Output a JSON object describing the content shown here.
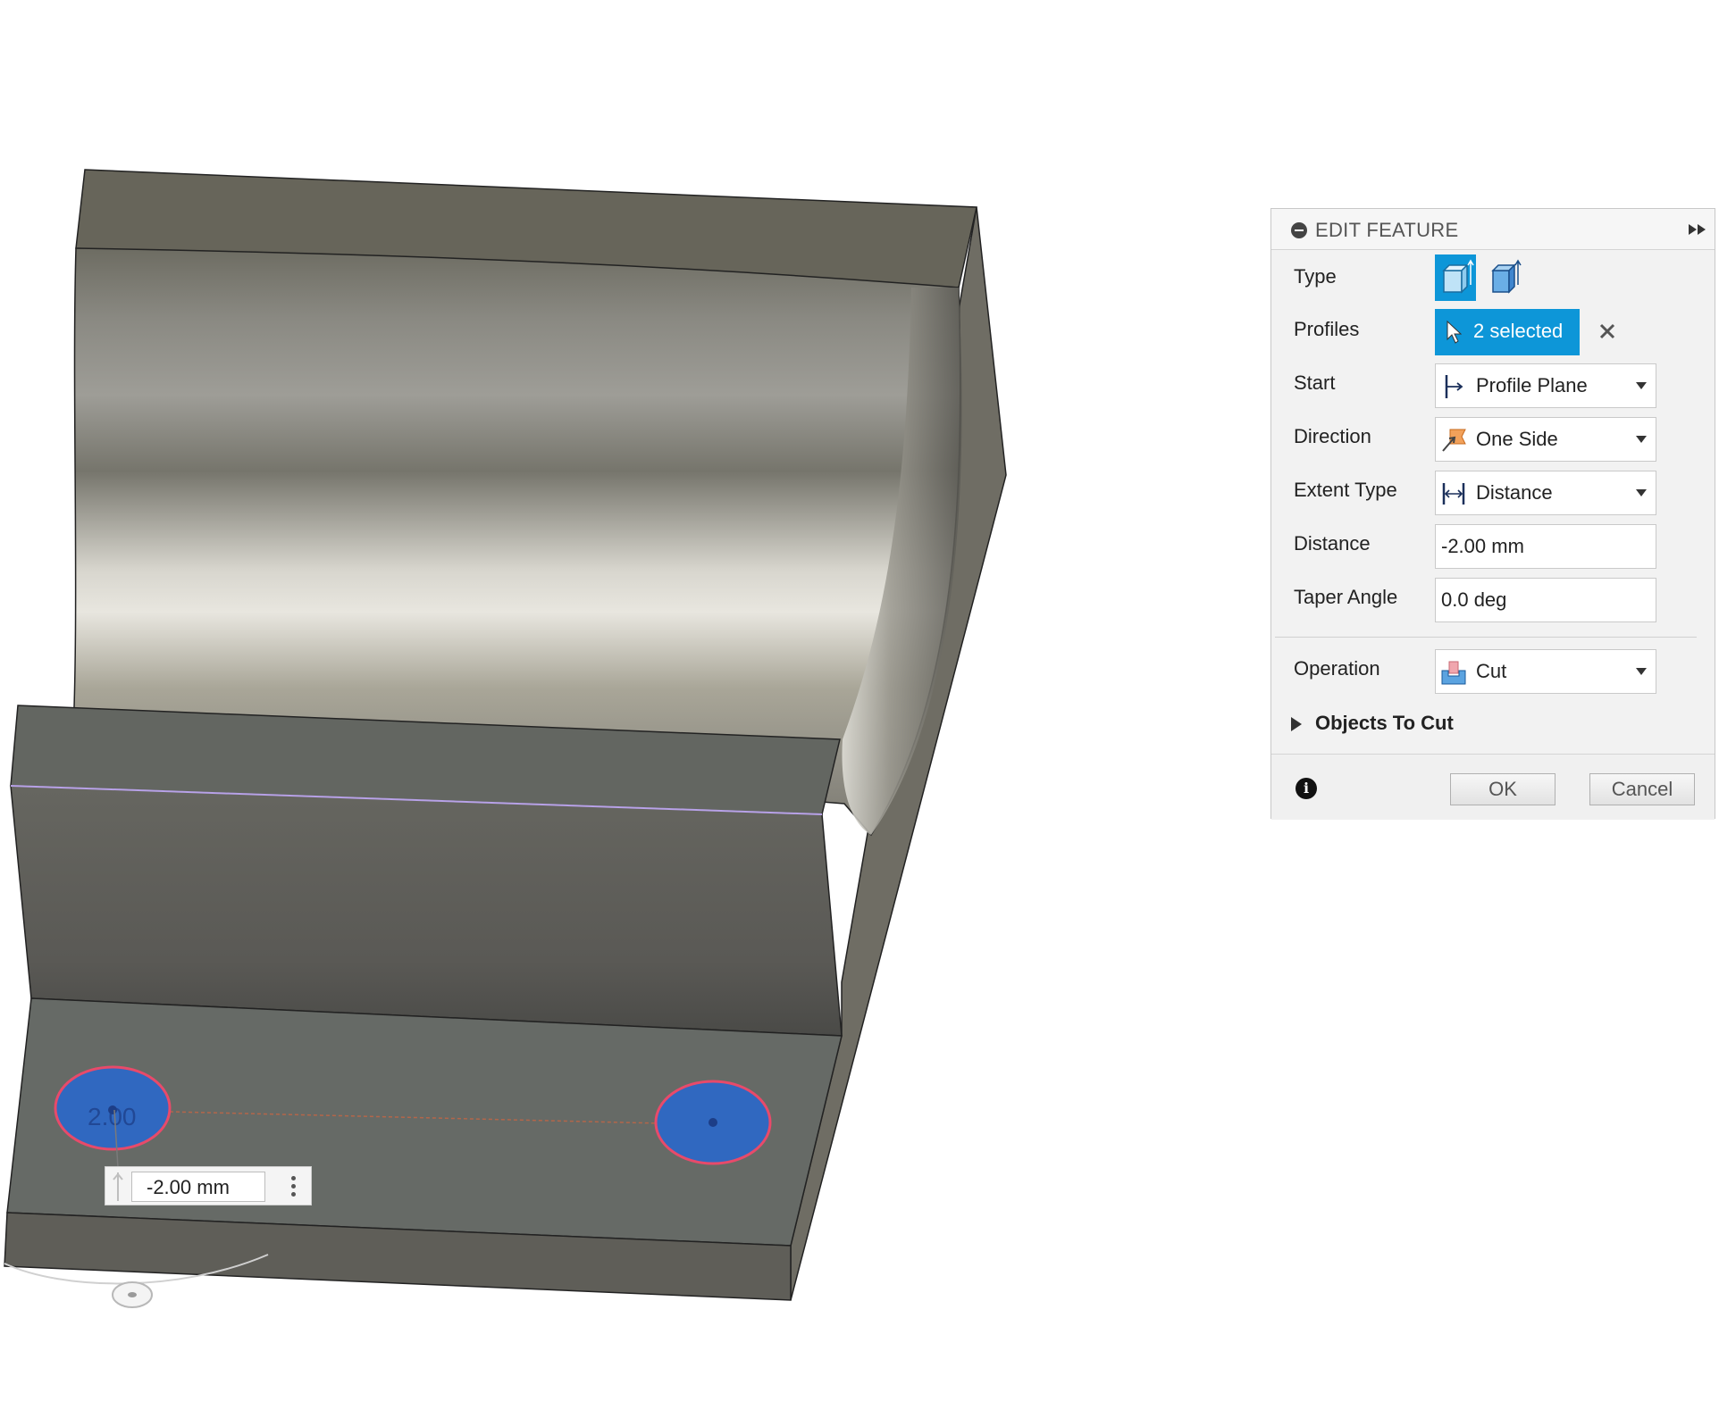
{
  "panel": {
    "title": "EDIT FEATURE",
    "rows": {
      "type": {
        "label": "Type"
      },
      "profiles": {
        "label": "Profiles",
        "value": "2 selected"
      },
      "start": {
        "label": "Start",
        "value": "Profile Plane"
      },
      "direction": {
        "label": "Direction",
        "value": "One Side"
      },
      "extent_type": {
        "label": "Extent Type",
        "value": "Distance"
      },
      "distance": {
        "label": "Distance",
        "value": "-2.00 mm"
      },
      "taper_angle": {
        "label": "Taper Angle",
        "value": "0.0 deg"
      },
      "operation": {
        "label": "Operation",
        "value": "Cut"
      }
    },
    "group": {
      "label": "Objects To Cut"
    },
    "buttons": {
      "ok": "OK",
      "cancel": "Cancel"
    },
    "accent_color": "#0d96d8"
  },
  "canvas": {
    "dimension_label": "2.00",
    "manipulator_value": "-2.00 mm",
    "profile_fill_color": "#3068c0",
    "profile_outline_color": "#e84a6a"
  }
}
